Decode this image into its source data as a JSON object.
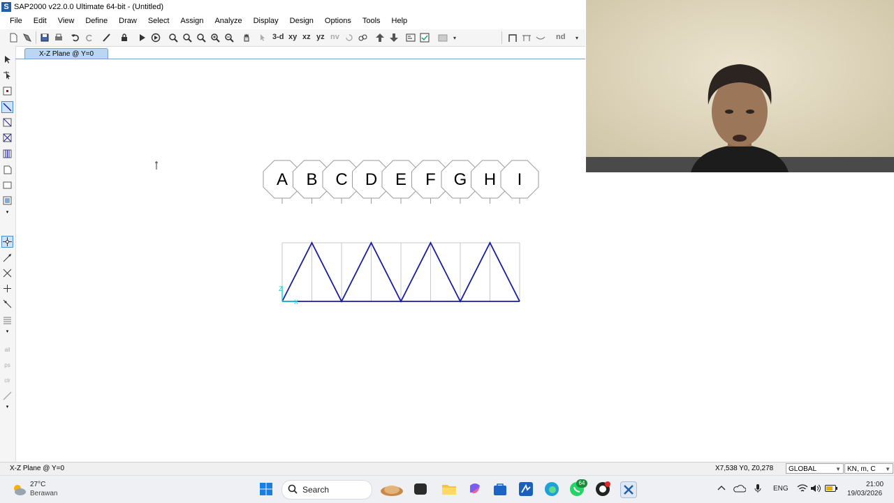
{
  "window": {
    "app_icon_letter": "S",
    "title": "SAP2000 v22.0.0 Ultimate 64-bit - (Untitled)"
  },
  "menu": [
    "File",
    "Edit",
    "View",
    "Define",
    "Draw",
    "Select",
    "Assign",
    "Analyze",
    "Display",
    "Design",
    "Options",
    "Tools",
    "Help"
  ],
  "toolbar": {
    "view_3d": "3-d",
    "view_xy": "xy",
    "view_xz": "xz",
    "view_yz": "yz",
    "view_nv": "nv",
    "nd_label": "nd"
  },
  "tab": {
    "label": "X-Z Plane @ Y=0"
  },
  "grid": {
    "bubbles": [
      "A",
      "B",
      "C",
      "D",
      "E",
      "F",
      "G",
      "H",
      "I"
    ]
  },
  "axis": {
    "z_label": "Z",
    "x_label": "X"
  },
  "statusbar": {
    "left": "X-Z Plane @ Y=0",
    "coords": "X7,538  Y0,  Z0,278",
    "coord_system": "GLOBAL",
    "units": "KN, m, C"
  },
  "taskbar": {
    "weather_temp": "27°C",
    "weather_desc": "Berawan",
    "search_label": "Search",
    "whatsapp_badge": "64",
    "lang": "ENG",
    "time": "21:00",
    "date": "19/03/2026"
  },
  "colors": {
    "frame": "#1a1aa8",
    "gridline": "#c8c8c8",
    "tab_bg": "#bcd6f2",
    "axis": "#14d2d2"
  }
}
